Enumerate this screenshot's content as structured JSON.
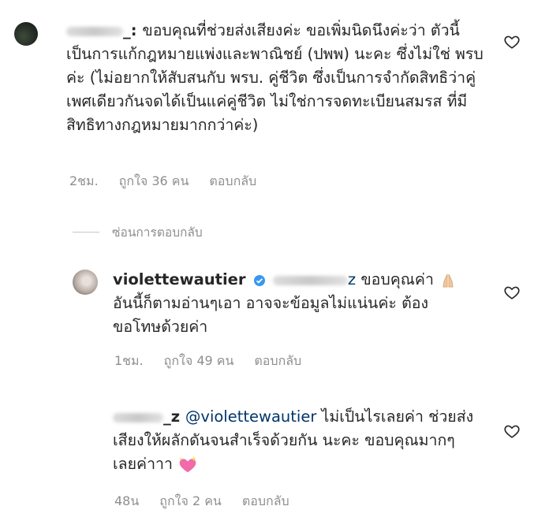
{
  "comments": [
    {
      "username_tail": "_:",
      "text": "ขอบคุณที่ช่วยส่งเสียงค่ะ ขอเพิ่มนิดนึงค่ะว่า ตัวนี้เป็นการแก้กฎหมายแพ่งและพาณิชย์ (ปพพ) นะคะ ซึ่งไม่ใช่ พรบ ค่ะ (ไม่อยากให้สับสนกับ พรบ. คู่ชีวิต ซึ่งเป็นการจำกัดสิทธิว่าคู่เพศเดียวกันจดได้เป็นแค่คู่ชีวิต ไม่ใช่การจดทะเบียนสมรส ที่มีสิทธิทางกฎหมายมากกว่าค่ะ)",
      "time": "2ชม.",
      "likes": "ถูกใจ 36 คน",
      "reply": "ตอบกลับ"
    }
  ],
  "hide_replies": "ซ่อนการตอบกลับ",
  "replies": [
    {
      "username": "violettewautier",
      "mention_tail": "z",
      "text": "ขอบคุณค่า",
      "text_cont": "อันนี้ก็ตามอ่านๆเอา อาจจะข้อมูลไม่แน่นค่ะ ต้องขอโทษด้วยค่า",
      "time": "1ชม.",
      "likes": "ถูกใจ 49 คน",
      "reply": "ตอบกลับ",
      "emoji": "folded-hands-icon"
    },
    {
      "username_tail": "_z",
      "mention": "@violettewautier",
      "text": "ไม่เป็นไรเลยค่า ช่วยส่งเสียงให้ผลักดันจนสำเร็จด้วยกัน นะคะ ขอบคุณมากๆเลยค่าาา",
      "time": "48น",
      "likes": "ถูกใจ 2 คน",
      "reply": "ตอบกลับ",
      "emoji": "sparkling-heart-icon"
    }
  ],
  "colors": {
    "text": "#262626",
    "meta": "#8e8e8e",
    "verified": "#3897f0"
  }
}
